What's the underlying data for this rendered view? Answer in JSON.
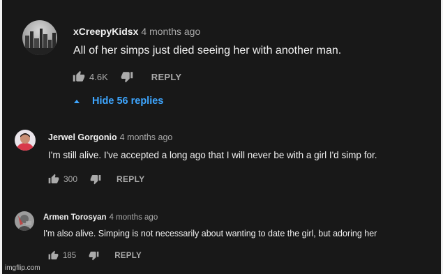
{
  "thread": {
    "top_comment": {
      "author": "xCreepyKidsx",
      "time": "4 months ago",
      "text": "All of her simps just died seeing her with another man.",
      "likes": "4.6K",
      "reply_label": "REPLY",
      "hide_replies": "Hide 56 replies",
      "like_icon": "thumbs-up-icon",
      "dislike_icon": "thumbs-down-icon"
    },
    "replies": [
      {
        "author": "Jerwel Gorgonio",
        "time": "4 months ago",
        "text": "I'm still alive. I've accepted a long ago that I will never be with a girl I'd simp for.",
        "likes": "300",
        "reply_label": "REPLY"
      },
      {
        "author": "Armen Torosyan",
        "time": "4 months ago",
        "text": "I'm also alive. Simping is not necessarily about wanting to date the girl, but adoring her",
        "likes": "185",
        "reply_label": "REPLY"
      }
    ]
  },
  "watermark": "imgflip.com",
  "colors": {
    "background": "#181818",
    "text": "#f1f1f1",
    "secondary_text": "#aaaaaa",
    "link_blue": "#3ea6ff"
  }
}
